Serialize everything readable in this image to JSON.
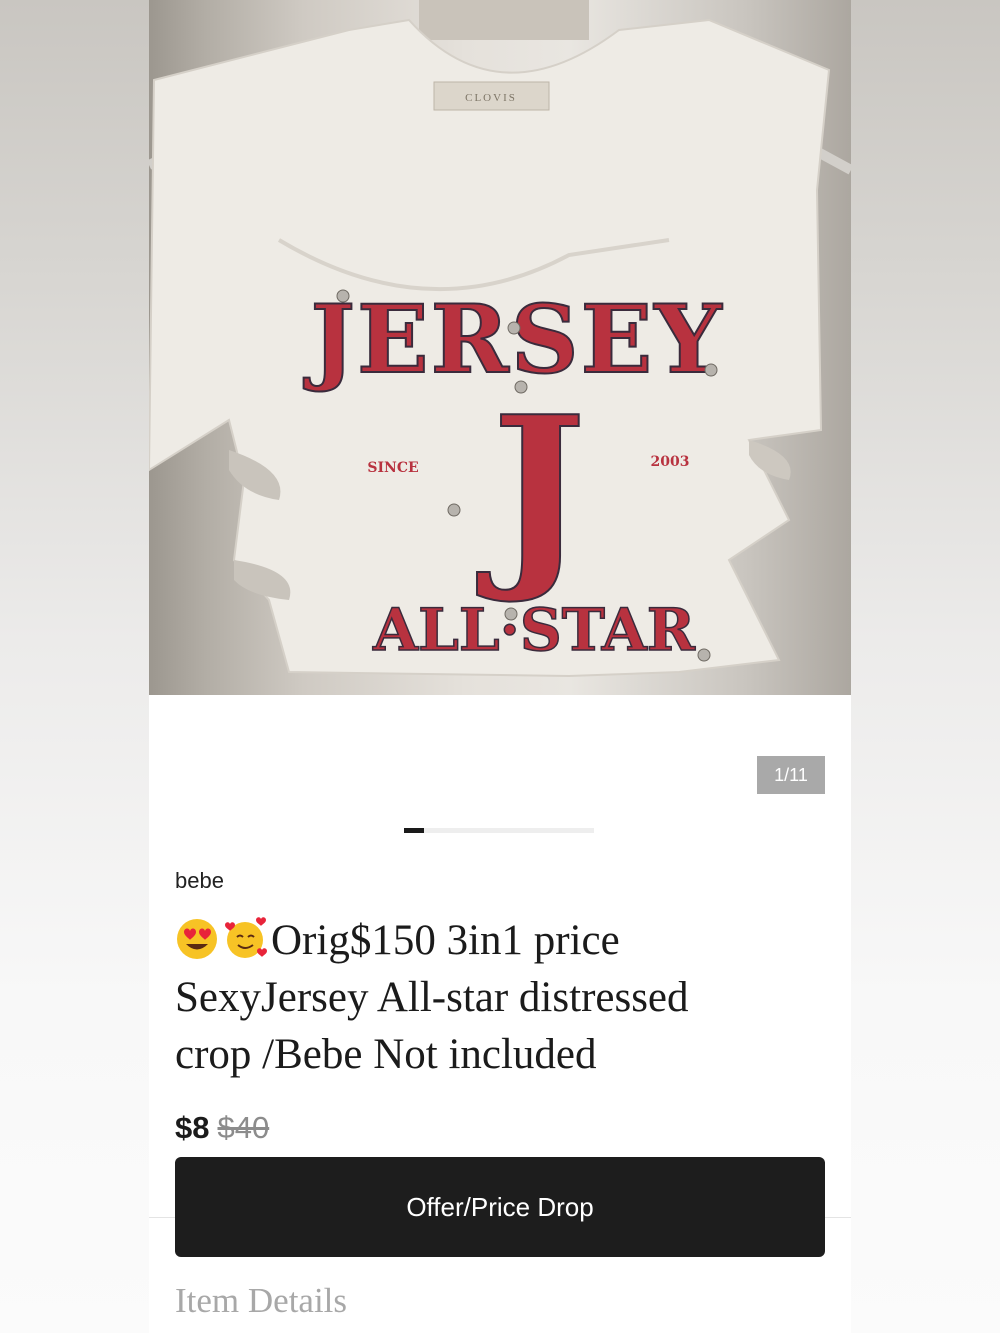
{
  "photo": {
    "tag_text": "CLOVIS",
    "print_top": "JERSEY",
    "print_letter": "J",
    "print_since": "SINCE",
    "print_year": "2003",
    "print_bottom": "ALL·STAR"
  },
  "gallery": {
    "counter": "1/11"
  },
  "product": {
    "brand": "bebe",
    "title_line1": "Orig$150 3in1 price",
    "title_line2": "SexyJersey All-star distressed",
    "title_line3": "crop /Bebe Not included",
    "emojis": [
      "heart-eyes-emoji-icon",
      "smiling-face-hearts-emoji-icon"
    ],
    "price": "$8",
    "original_price": "$40"
  },
  "actions": {
    "offer_label": "Offer/Price Drop"
  },
  "sections": {
    "item_details": "Item Details"
  },
  "colors": {
    "print_red": "#b8323f",
    "button_bg": "#1d1d1d",
    "counter_bg": "#a9a9a9"
  }
}
